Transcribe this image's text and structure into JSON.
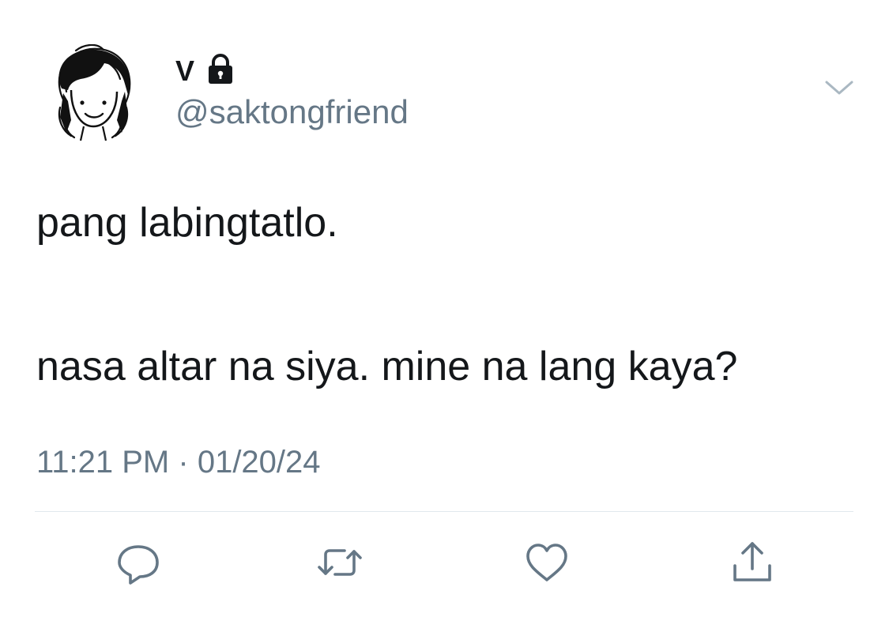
{
  "tweet": {
    "author": {
      "display_name": "V",
      "handle": "@saktongfriend",
      "protected": true,
      "avatar_icon": "sketched-girl-avatar",
      "lock_icon": "lock-icon"
    },
    "text_lines": [
      "pang labingtatlo.",
      "nasa altar na siya. mine na lang kaya?"
    ],
    "time": "11:21 PM",
    "separator": "·",
    "date": "01/20/24",
    "menu_icon": "chevron-down-icon"
  },
  "actions": [
    {
      "icon": "reply-icon"
    },
    {
      "icon": "retweet-icon"
    },
    {
      "icon": "like-icon"
    },
    {
      "icon": "share-icon"
    }
  ],
  "colors": {
    "text_primary": "#14171a",
    "text_secondary": "#657786",
    "icon": "#657786",
    "divider": "#e1e8ed",
    "background": "#ffffff"
  }
}
